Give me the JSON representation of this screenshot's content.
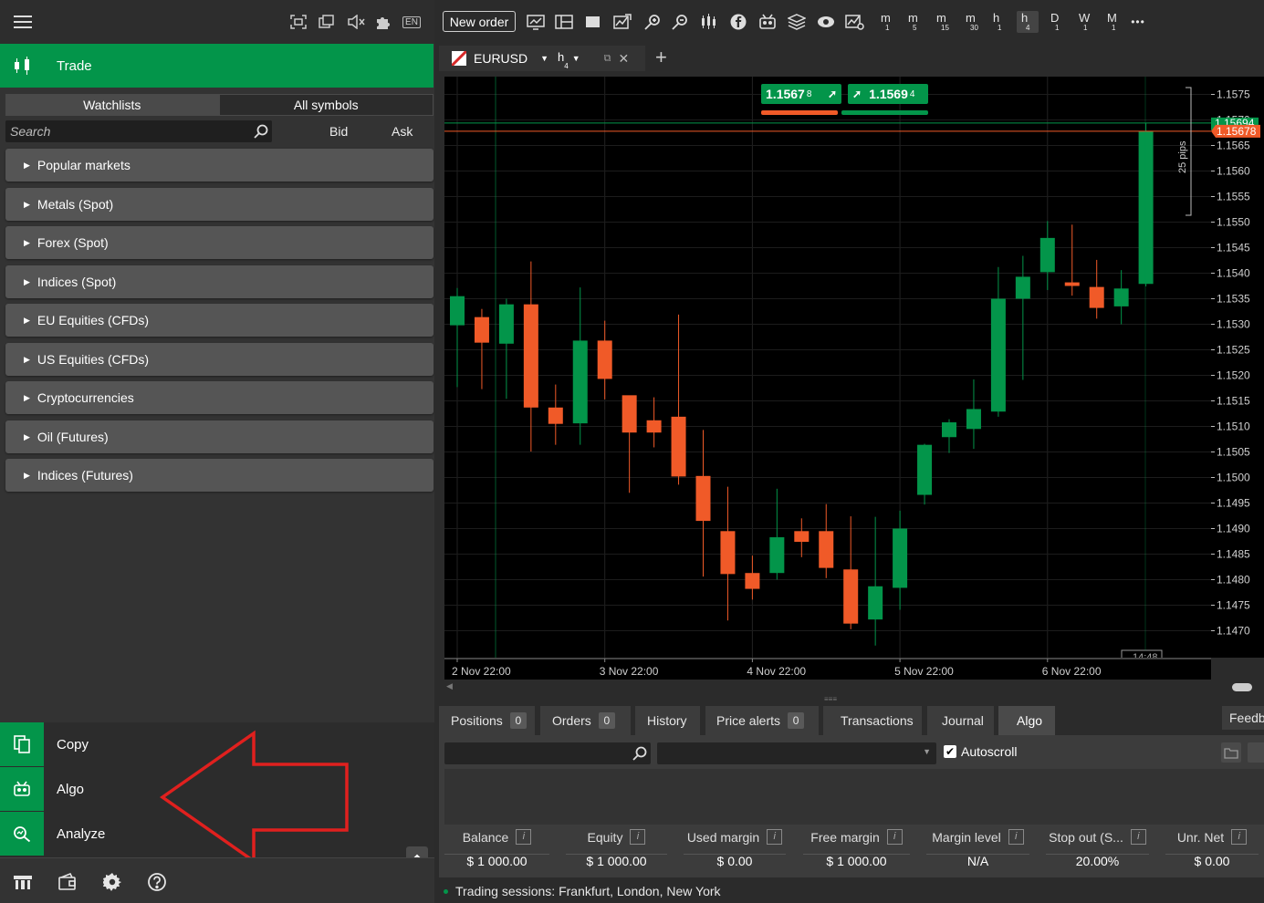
{
  "sidebar": {
    "trade_label": "Trade",
    "watchlist_tabs": [
      "Watchlists",
      "All symbols"
    ],
    "search_placeholder": "Search",
    "columns": {
      "bid": "Bid",
      "ask": "Ask"
    },
    "categories": [
      "Popular markets",
      "Metals (Spot)",
      "Forex (Spot)",
      "Indices (Spot)",
      "EU Equities (CFDs)",
      "US Equities (CFDs)",
      "Cryptocurrencies",
      "Oil (Futures)",
      "Indices (Futures)"
    ],
    "language": "EN",
    "bottom_menu": [
      {
        "label": "Copy",
        "icon": "copy-icon"
      },
      {
        "label": "Algo",
        "icon": "robot-icon"
      },
      {
        "label": "Analyze",
        "icon": "analyze-icon"
      }
    ]
  },
  "toolbar": {
    "new_order_label": "New order",
    "timeframes": [
      {
        "main": "m",
        "sub": "1",
        "active": false
      },
      {
        "main": "m",
        "sub": "5",
        "active": false
      },
      {
        "main": "m",
        "sub": "15",
        "active": false
      },
      {
        "main": "m",
        "sub": "30",
        "active": false
      },
      {
        "main": "h",
        "sub": "1",
        "active": false
      },
      {
        "main": "h",
        "sub": "4",
        "active": true
      },
      {
        "main": "D",
        "sub": "1",
        "active": false
      },
      {
        "main": "W",
        "sub": "1",
        "active": false
      },
      {
        "main": "M",
        "sub": "1",
        "active": false
      }
    ],
    "more_label": "•••"
  },
  "chart_tab": {
    "symbol": "EURUSD",
    "timeframe_main": "h",
    "timeframe_sub": "4",
    "add_label": "+"
  },
  "quote": {
    "sell_price": "1.1567",
    "sell_pip": "8",
    "buy_price": "1.1569",
    "buy_pip": "4",
    "bid_label": "1.15678",
    "ask_label": "1.15694",
    "pips_label": "25 pips",
    "time_label": "14:48"
  },
  "colors": {
    "bull": "#03954a",
    "bear": "#f05a28",
    "accent": "#03954a",
    "arrow": "#e0201e"
  },
  "chart_data": {
    "type": "candlestick",
    "symbol": "EURUSD",
    "timeframe": "h4",
    "ylim": [
      1.1465,
      1.158
    ],
    "y_ticks": [
      "1.1575",
      "1.1570",
      "1.1565",
      "1.1560",
      "1.1555",
      "1.1550",
      "1.1545",
      "1.1540",
      "1.1535",
      "1.1530",
      "1.1525",
      "1.1520",
      "1.1515",
      "1.1510",
      "1.1505",
      "1.1500",
      "1.1495",
      "1.1490",
      "1.1485",
      "1.1480",
      "1.1475",
      "1.1470"
    ],
    "y_tick_values": [
      1.1575,
      1.157,
      1.1565,
      1.156,
      1.1555,
      1.155,
      1.1545,
      1.154,
      1.1535,
      1.153,
      1.1525,
      1.152,
      1.1515,
      1.151,
      1.1505,
      1.15,
      1.1495,
      1.149,
      1.1485,
      1.148,
      1.1475,
      1.147
    ],
    "x_labels": [
      {
        "label": "2 Nov 22:00",
        "index": 0
      },
      {
        "label": "3 Nov 22:00",
        "index": 6
      },
      {
        "label": "4 Nov 22:00",
        "index": 12
      },
      {
        "label": "5 Nov 22:00",
        "index": 18
      },
      {
        "label": "6 Nov 22:00",
        "index": 24
      }
    ],
    "candles": [
      {
        "o": 1.15298,
        "h": 1.15371,
        "l": 1.15177,
        "c": 1.15355
      },
      {
        "o": 1.15314,
        "h": 1.1533,
        "l": 1.15173,
        "c": 1.15264
      },
      {
        "o": 1.15262,
        "h": 1.1535,
        "l": 1.15154,
        "c": 1.15339
      },
      {
        "o": 1.15339,
        "h": 1.15423,
        "l": 1.15051,
        "c": 1.15137
      },
      {
        "o": 1.15137,
        "h": 1.15182,
        "l": 1.15064,
        "c": 1.15105
      },
      {
        "o": 1.15106,
        "h": 1.15372,
        "l": 1.15064,
        "c": 1.15268
      },
      {
        "o": 1.15268,
        "h": 1.15307,
        "l": 1.15153,
        "c": 1.15193
      },
      {
        "o": 1.15161,
        "h": 1.15153,
        "l": 1.1497,
        "c": 1.15088
      },
      {
        "o": 1.15112,
        "h": 1.15157,
        "l": 1.15059,
        "c": 1.15088
      },
      {
        "o": 1.15119,
        "h": 1.15319,
        "l": 1.14986,
        "c": 1.15002
      },
      {
        "o": 1.15003,
        "h": 1.15093,
        "l": 1.14806,
        "c": 1.14915
      },
      {
        "o": 1.14895,
        "h": 1.14982,
        "l": 1.1472,
        "c": 1.14811
      },
      {
        "o": 1.14813,
        "h": 1.14847,
        "l": 1.14761,
        "c": 1.14782
      },
      {
        "o": 1.14813,
        "h": 1.14978,
        "l": 1.148,
        "c": 1.14883
      },
      {
        "o": 1.14895,
        "h": 1.1492,
        "l": 1.14844,
        "c": 1.14874
      },
      {
        "o": 1.14895,
        "h": 1.14948,
        "l": 1.14803,
        "c": 1.14823
      },
      {
        "o": 1.1482,
        "h": 1.14924,
        "l": 1.14703,
        "c": 1.14714
      },
      {
        "o": 1.14722,
        "h": 1.14923,
        "l": 1.14671,
        "c": 1.14787
      },
      {
        "o": 1.14784,
        "h": 1.14935,
        "l": 1.14741,
        "c": 1.149
      },
      {
        "o": 1.14966,
        "h": 1.15066,
        "l": 1.14947,
        "c": 1.15064
      },
      {
        "o": 1.15079,
        "h": 1.15114,
        "l": 1.15048,
        "c": 1.15108
      },
      {
        "o": 1.15095,
        "h": 1.15192,
        "l": 1.15056,
        "c": 1.15134
      },
      {
        "o": 1.15129,
        "h": 1.15412,
        "l": 1.15119,
        "c": 1.1535
      },
      {
        "o": 1.1535,
        "h": 1.15434,
        "l": 1.15191,
        "c": 1.15393
      },
      {
        "o": 1.15402,
        "h": 1.15502,
        "l": 1.15367,
        "c": 1.15469
      },
      {
        "o": 1.15382,
        "h": 1.15495,
        "l": 1.15356,
        "c": 1.15375
      },
      {
        "o": 1.15373,
        "h": 1.15426,
        "l": 1.15311,
        "c": 1.15332
      },
      {
        "o": 1.15335,
        "h": 1.15406,
        "l": 1.153,
        "c": 1.1537
      },
      {
        "o": 1.15379,
        "h": 1.15694,
        "l": 1.15374,
        "c": 1.15678
      }
    ],
    "bid": 1.15678,
    "ask": 1.15694
  },
  "bottom_tabs": [
    {
      "label": "Positions",
      "badge": "0",
      "active": false
    },
    {
      "label": "Orders",
      "badge": "0",
      "active": false
    },
    {
      "label": "History",
      "badge": null,
      "active": false
    },
    {
      "label": "Price alerts",
      "badge": "0",
      "active": false
    },
    {
      "label": "Transactions",
      "badge": null,
      "active": false
    },
    {
      "label": "Journal",
      "badge": null,
      "active": false
    },
    {
      "label": "Algo",
      "badge": null,
      "active": true
    },
    {
      "label": "Feedb",
      "badge": null,
      "active": false
    }
  ],
  "algo": {
    "autoscroll_label": "Autoscroll",
    "autoscroll_checked": true
  },
  "account": [
    {
      "label": "Balance",
      "value": "$ 1 000.00"
    },
    {
      "label": "Equity",
      "value": "$ 1 000.00"
    },
    {
      "label": "Used margin",
      "value": "$ 0.00"
    },
    {
      "label": "Free margin",
      "value": "$ 1 000.00"
    },
    {
      "label": "Margin level",
      "value": "N/A"
    },
    {
      "label": "Stop out (S...",
      "value": "20.00%"
    },
    {
      "label": "Unr. Net",
      "value": "$ 0.00"
    }
  ],
  "status": {
    "text": "Trading sessions: Frankfurt, London, New York"
  }
}
